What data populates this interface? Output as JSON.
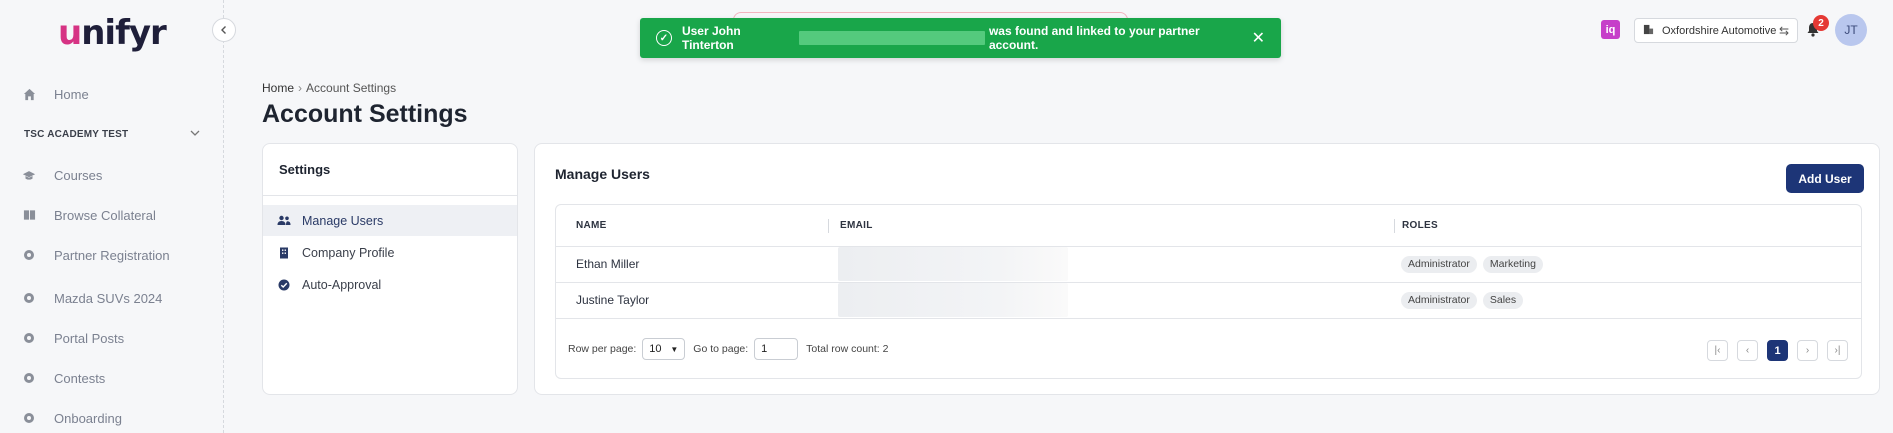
{
  "brand": {
    "logo_first": "u",
    "logo_rest": "nifyr"
  },
  "sidebar": {
    "home_label": "Home",
    "section_label": "TSC ACADEMY TEST",
    "items": [
      {
        "label": "Courses",
        "icon": "graduation-cap-icon"
      },
      {
        "label": "Browse Collateral",
        "icon": "book-icon"
      },
      {
        "label": "Partner Registration",
        "icon": "circle-icon"
      },
      {
        "label": "Mazda SUVs 2024",
        "icon": "circle-icon"
      },
      {
        "label": "Portal Posts",
        "icon": "circle-icon"
      },
      {
        "label": "Contests",
        "icon": "circle-icon"
      },
      {
        "label": "Onboarding",
        "icon": "circle-icon"
      }
    ]
  },
  "header": {
    "iq_label": "iq",
    "org_name": "Oxfordshire Automotive",
    "notification_count": "2",
    "avatar_initials": "JT"
  },
  "toast": {
    "prefix": "User John Tinterton",
    "suffix": "was found and linked to your partner account.",
    "close": "✕",
    "status_color": "#19a64a"
  },
  "breadcrumb": {
    "home": "Home",
    "separator": "›",
    "current": "Account Settings"
  },
  "page": {
    "title": "Account Settings"
  },
  "settings": {
    "title": "Settings",
    "items": [
      {
        "label": "Manage Users",
        "active": true
      },
      {
        "label": "Company Profile",
        "active": false
      },
      {
        "label": "Auto-Approval",
        "active": false
      }
    ]
  },
  "users": {
    "title": "Manage Users",
    "add_button": "Add User",
    "columns": [
      "NAME",
      "EMAIL",
      "ROLES"
    ],
    "rows": [
      {
        "name": "Ethan Miller",
        "roles": [
          "Administrator",
          "Marketing"
        ]
      },
      {
        "name": "Justine Taylor",
        "roles": [
          "Administrator",
          "Sales"
        ]
      }
    ],
    "pagination": {
      "rows_per_page_label": "Row per page:",
      "rows_per_page": "10",
      "goto_label": "Go to page:",
      "goto_value": "1",
      "total_label": "Total row count: 2",
      "current_page": "1"
    }
  },
  "colors": {
    "accent": "#1d3577",
    "logo_accent": "#d63384",
    "success": "#19a64a"
  }
}
